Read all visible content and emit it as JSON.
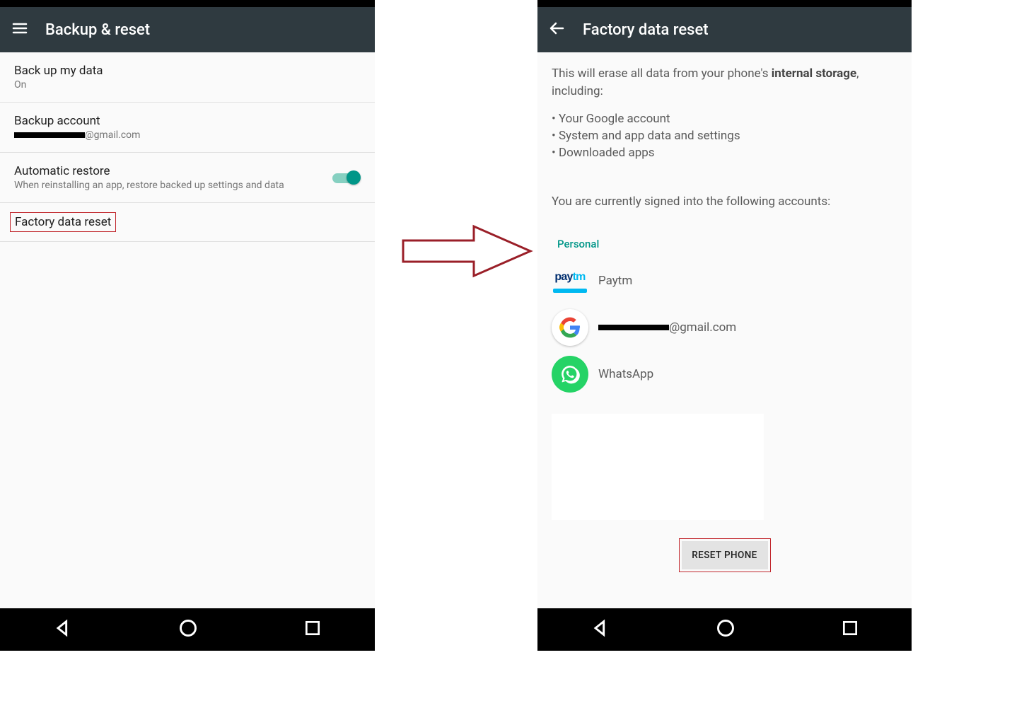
{
  "left": {
    "title": "Backup & reset",
    "items": {
      "backup_data": {
        "label": "Back up my data",
        "value": "On"
      },
      "backup_account": {
        "label": "Backup account",
        "email_suffix": "@gmail.com"
      },
      "auto_restore": {
        "label": "Automatic restore",
        "desc": "When reinstalling an app, restore backed up settings and data",
        "on": true
      },
      "factory_reset": {
        "label": "Factory data reset"
      }
    }
  },
  "right": {
    "title": "Factory data reset",
    "intro_prefix": "This will erase all data from your phone's ",
    "intro_bold": "internal storage",
    "intro_suffix": ", including:",
    "bullets": [
      "Your Google account",
      "System and app data and settings",
      "Downloaded apps"
    ],
    "signed_in": "You are currently signed into the following accounts:",
    "section": "Personal",
    "accounts": {
      "paytm": "Paytm",
      "google_suffix": "@gmail.com",
      "whatsapp": "WhatsApp"
    },
    "reset_btn": "RESET PHONE"
  }
}
